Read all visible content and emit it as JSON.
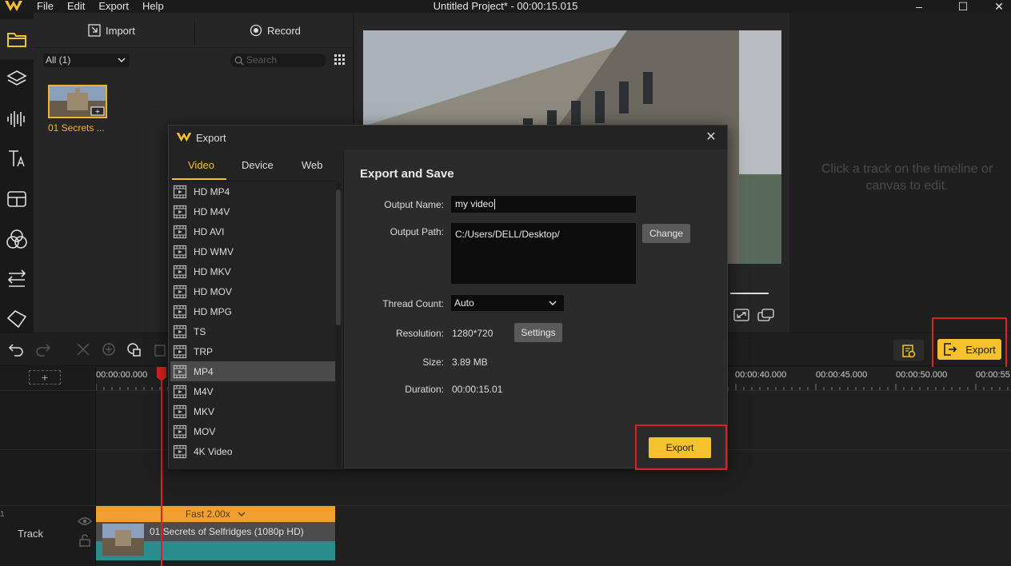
{
  "window": {
    "title": "Untitled Project* - 00:00:15.015",
    "menu": [
      "File",
      "Edit",
      "Export",
      "Help"
    ],
    "minimize": "–",
    "maximize": "☐",
    "close": "✕"
  },
  "media": {
    "import_label": "Import",
    "record_label": "Record",
    "filter_value": "All (1)",
    "search_placeholder": "Search",
    "item_label": "01 Secrets ..."
  },
  "props": {
    "hint": "Click a track on the timeline or canvas to edit."
  },
  "toolbar": {
    "export_label": "Export"
  },
  "timeline": {
    "ruler": [
      "00:00:00.000",
      "00:00:40.000",
      "00:00:45.000",
      "00:00:50.000",
      "00:00:55"
    ],
    "add_track": "+",
    "track_number": "1",
    "track_label": "Track",
    "clip_speed": "Fast 2.00x",
    "clip_title": "01 Secrets of Selfridges (1080p HD)"
  },
  "dialog": {
    "title": "Export",
    "tabs": [
      "Video",
      "Device",
      "Web"
    ],
    "formats": [
      "HD MP4",
      "HD M4V",
      "HD AVI",
      "HD WMV",
      "HD MKV",
      "HD MOV",
      "HD MPG",
      "TS",
      "TRP",
      "MP4",
      "M4V",
      "MKV",
      "MOV",
      "4K Video"
    ],
    "selected_format": "MP4",
    "save_title": "Export and Save",
    "output_name_label": "Output Name:",
    "output_name_value": "my video",
    "output_path_label": "Output Path:",
    "output_path_value": "C:/Users/DELL/Desktop/",
    "change_label": "Change",
    "thread_label": "Thread Count:",
    "thread_value": "Auto",
    "resolution_label": "Resolution:",
    "resolution_value": "1280*720",
    "settings_label": "Settings",
    "size_label": "Size:",
    "size_value": "3.89 MB",
    "duration_label": "Duration:",
    "duration_value": "00:00:15.01",
    "export_label": "Export"
  },
  "colors": {
    "accent": "#f5c12c",
    "highlight_box": "#e02020"
  }
}
